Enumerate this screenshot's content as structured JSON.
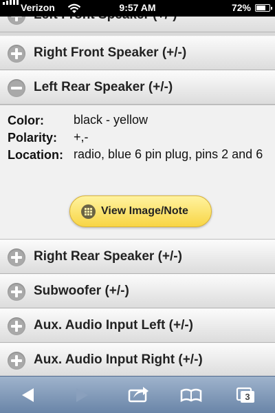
{
  "status_bar": {
    "carrier": "Verizon",
    "time": "9:57 AM",
    "battery_pct": "72%",
    "battery_level": 0.72,
    "icons": [
      "signal-bars-icon",
      "wifi-icon",
      "battery-icon"
    ]
  },
  "accordion": {
    "rows_above": [
      {
        "label": "Left Front Speaker (+/-)",
        "icon": "plus-icon"
      },
      {
        "label": "Right Front Speaker (+/-)",
        "icon": "plus-icon"
      }
    ],
    "expanded": {
      "label": "Left Rear Speaker (+/-)",
      "icon": "minus-icon",
      "details": {
        "color_label": "Color:",
        "color_value": "black - yellow",
        "polarity_label": "Polarity:",
        "polarity_value": "+,-",
        "location_label": "Location:",
        "location_value": "radio, blue 6 pin plug, pins 2 and 6"
      },
      "button": {
        "label": "View Image/Note",
        "icon": "grid-icon"
      }
    },
    "rows_below": [
      {
        "label": "Right Rear Speaker (+/-)",
        "icon": "plus-icon"
      },
      {
        "label": "Subwoofer (+/-)",
        "icon": "plus-icon"
      },
      {
        "label": "Aux. Audio Input Left (+/-)",
        "icon": "plus-icon"
      },
      {
        "label": "Aux. Audio Input Right (+/-)",
        "icon": "plus-icon"
      }
    ]
  },
  "toolbar": {
    "icons": [
      "back-icon",
      "forward-icon",
      "share-icon",
      "bookmarks-icon",
      "tabs-icon"
    ],
    "tabs_count": "3"
  }
}
